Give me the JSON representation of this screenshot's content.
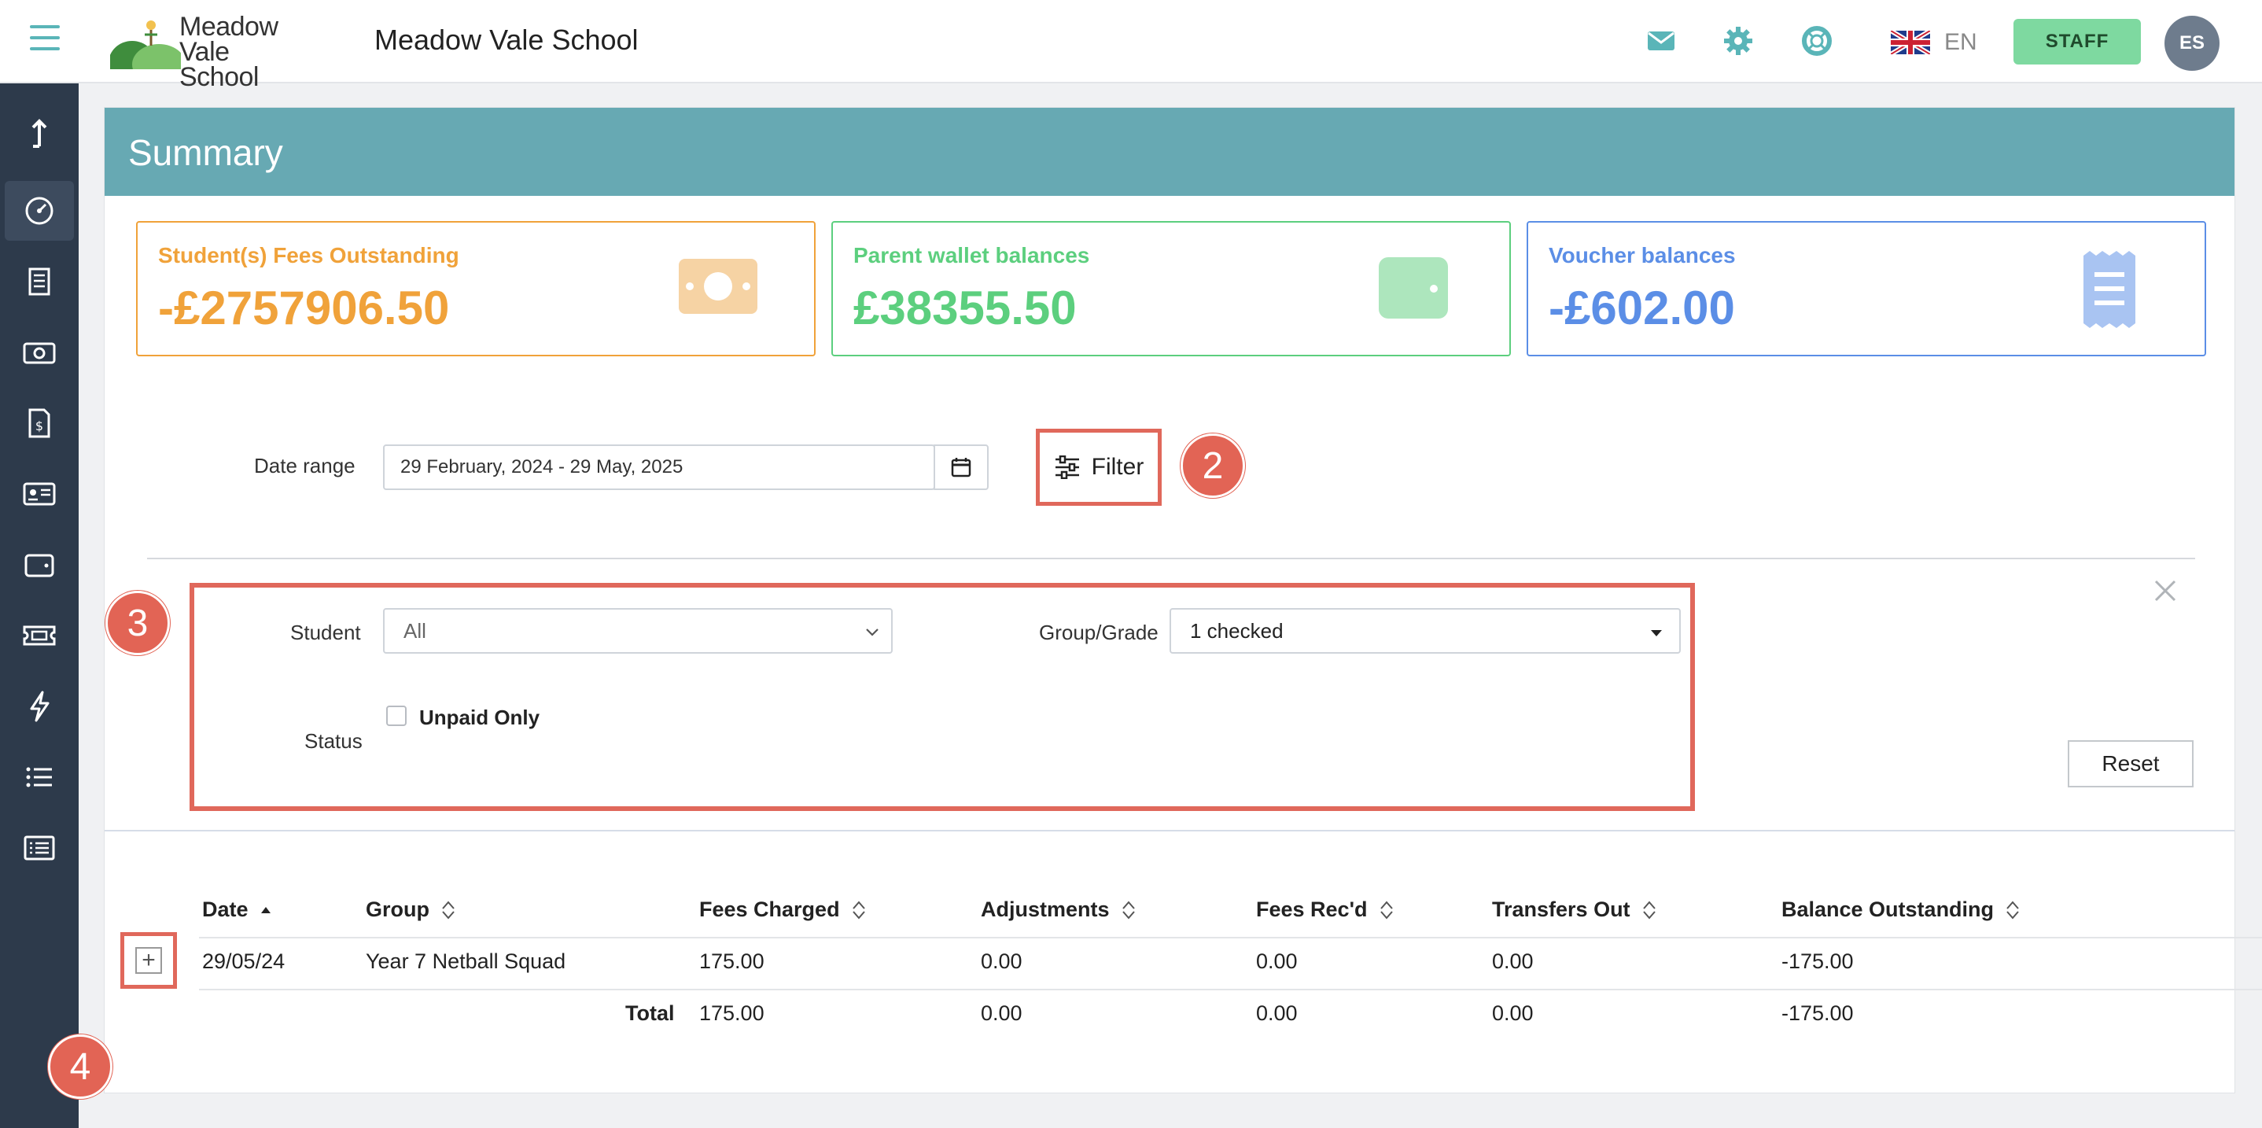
{
  "header": {
    "logo_line1": "Meadow",
    "logo_line2": "Vale School",
    "school_name": "Meadow Vale School",
    "language": "EN",
    "staff_label": "STAFF",
    "avatar_initials": "ES",
    "icons": [
      "menu-icon",
      "mail-icon",
      "gear-icon",
      "help-lifebuoy-icon",
      "uk-flag-icon"
    ]
  },
  "sidebar": {
    "items": [
      {
        "name": "upload-icon"
      },
      {
        "name": "dashboard-icon",
        "active": true
      },
      {
        "name": "receipt-icon"
      },
      {
        "name": "cash-icon"
      },
      {
        "name": "invoice-icon"
      },
      {
        "name": "id-card-icon"
      },
      {
        "name": "wallet-icon"
      },
      {
        "name": "ticket-icon"
      },
      {
        "name": "lightning-icon"
      },
      {
        "name": "list-icon"
      },
      {
        "name": "report-list-icon"
      }
    ]
  },
  "summary": {
    "title": "Summary",
    "stats": [
      {
        "label": "Student(s) Fees Outstanding",
        "value": "-£2757906.50",
        "color": "#f0a23a",
        "icon": "banknote-icon"
      },
      {
        "label": "Parent wallet balances",
        "value": "£38355.50",
        "color": "#5ccf7e",
        "icon": "wallet-icon"
      },
      {
        "label": "Voucher balances",
        "value": "-£602.00",
        "color": "#5b8ee6",
        "icon": "voucher-icon"
      }
    ]
  },
  "filters": {
    "date_range_label": "Date range",
    "date_range_value": "29 February, 2024 - 29 May, 2025",
    "filter_button": "Filter",
    "student_label": "Student",
    "student_value": "All",
    "group_label": "Group/Grade",
    "group_value": "1 checked",
    "status_label": "Status",
    "unpaid_only_label": "Unpaid Only",
    "reset_button": "Reset"
  },
  "callouts": [
    "2",
    "3",
    "4"
  ],
  "table": {
    "columns": [
      "Date",
      "Group",
      "Fees Charged",
      "Adjustments",
      "Fees Rec'd",
      "Transfers Out",
      "Balance Outstanding"
    ],
    "rows": [
      {
        "date": "29/05/24",
        "group": "Year 7 Netball Squad",
        "fees_charged": "175.00",
        "adjustments": "0.00",
        "fees_recd": "0.00",
        "transfers_out": "0.00",
        "balance": "-175.00"
      }
    ],
    "total": {
      "label": "Total",
      "fees_charged": "175.00",
      "adjustments": "0.00",
      "fees_recd": "0.00",
      "transfers_out": "0.00",
      "balance": "-175.00"
    },
    "expand_symbol": "+"
  }
}
